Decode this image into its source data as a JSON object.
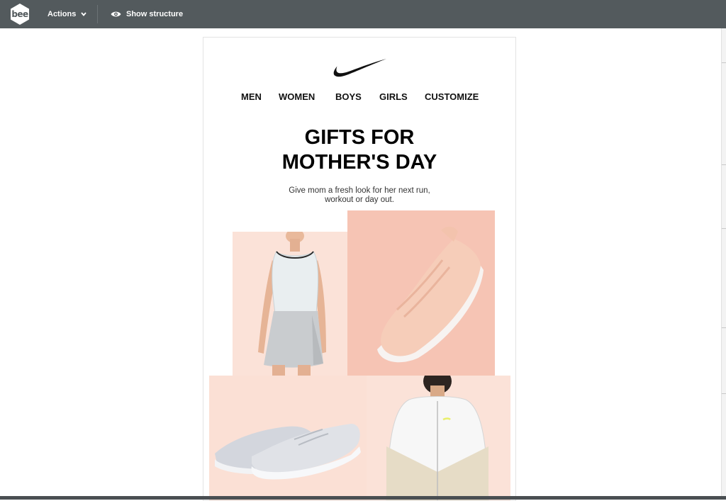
{
  "toolbar": {
    "logo_text": "bee",
    "actions_label": "Actions",
    "show_structure_label": "Show structure"
  },
  "email": {
    "nav": [
      "MEN",
      "WOMEN",
      "BOYS",
      "GIRLS",
      "CUSTOMIZE"
    ],
    "headline_line1": "GIFTS FOR",
    "headline_line2": "MOTHER'S DAY",
    "subtext_line1": "Give mom a fresh look for her next run,",
    "subtext_line2": "workout or day out."
  },
  "colors": {
    "toolbar_bg": "#535a5d",
    "tile_peach_light": "#fbe2d8",
    "tile_peach": "#f6c4b4"
  }
}
